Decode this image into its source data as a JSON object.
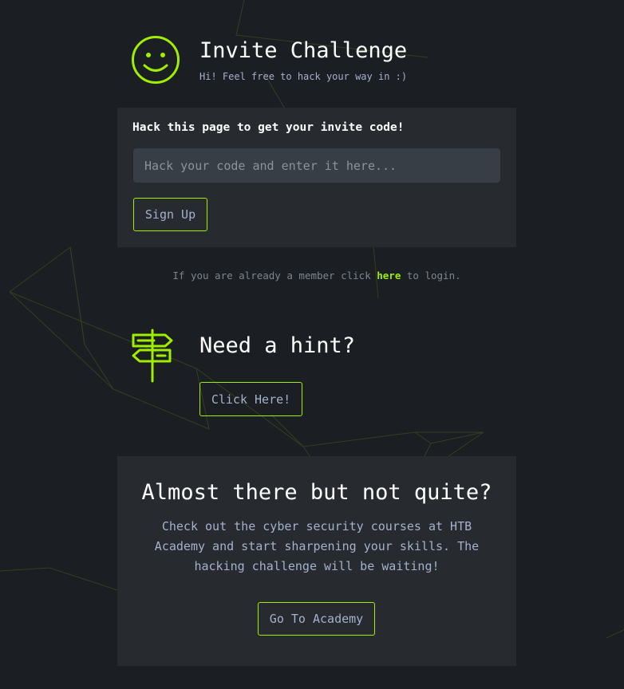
{
  "header": {
    "title": "Invite Challenge",
    "subtitle": "Hi! Feel free to hack your way in :)"
  },
  "invite_form": {
    "heading": "Hack this page to get your invite code!",
    "code_placeholder": "Hack your code and enter it here...",
    "code_value": "",
    "signup_label": "Sign Up"
  },
  "login": {
    "prefix": "If you are already a member click ",
    "link_label": "here",
    "suffix": " to login."
  },
  "hint": {
    "title": "Need a hint?",
    "button_label": "Click Here!"
  },
  "academy": {
    "title": "Almost there but not quite?",
    "text": "Check out the cyber security courses at HTB Academy and start sharpening your skills. The hacking challenge will be waiting!",
    "button_label": "Go To Academy"
  },
  "icons": {
    "header_icon": "smiley-icon",
    "hint_icon": "signpost-icon"
  },
  "colors": {
    "accent": "#9fef00",
    "background": "#1b1e22",
    "card": "#272b30",
    "input": "#383e45",
    "muted_text": "#a4b1cd"
  }
}
